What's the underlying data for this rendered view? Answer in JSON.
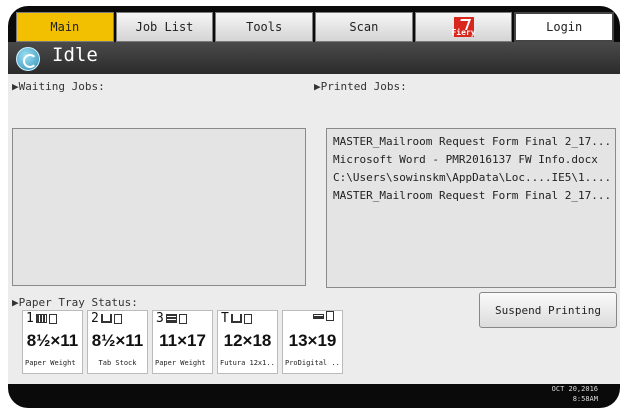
{
  "tabs": [
    {
      "label": "Main",
      "active": true
    },
    {
      "label": "Job List",
      "active": false
    },
    {
      "label": "Tools",
      "active": false
    },
    {
      "label": "Scan",
      "active": false
    },
    {
      "label": "Fiery",
      "icon": "fiery-logo-icon",
      "active": false
    },
    {
      "label": "Login",
      "active": false
    }
  ],
  "status": {
    "text": "Idle",
    "icon": "printer-status-icon"
  },
  "waiting_jobs": {
    "label": "▶Waiting Jobs:",
    "items": []
  },
  "printed_jobs": {
    "label": "▶Printed Jobs:",
    "items": [
      "MASTER_Mailroom Request Form Final 2_17...",
      "Microsoft Word - PMR2016137 FW Info.docx",
      "C:\\Users\\sowinskm\\AppData\\Loc....IE5\\1....",
      "MASTER_Mailroom Request Form Final 2_17..."
    ]
  },
  "paper_tray": {
    "label": "▶Paper Tray Status:",
    "trays": [
      {
        "id": "1",
        "size": "8½×11",
        "type": "Paper Weight 3"
      },
      {
        "id": "2",
        "size": "8½×11",
        "type": "Tab Stock"
      },
      {
        "id": "3",
        "size": "11×17",
        "type": "Paper Weight 3"
      },
      {
        "id": "T",
        "size": "12×18",
        "type": "Futura 12x1..."
      },
      {
        "id": "",
        "size": "13×19",
        "type": "ProDigital ..."
      }
    ]
  },
  "suspend_button": "Suspend Printing",
  "clock": {
    "date": "OCT  20,2016",
    "time": "8:58AM"
  },
  "colors": {
    "active_tab": "#f2c000",
    "status_bar": "#333333",
    "panel_bg": "#ececec"
  }
}
